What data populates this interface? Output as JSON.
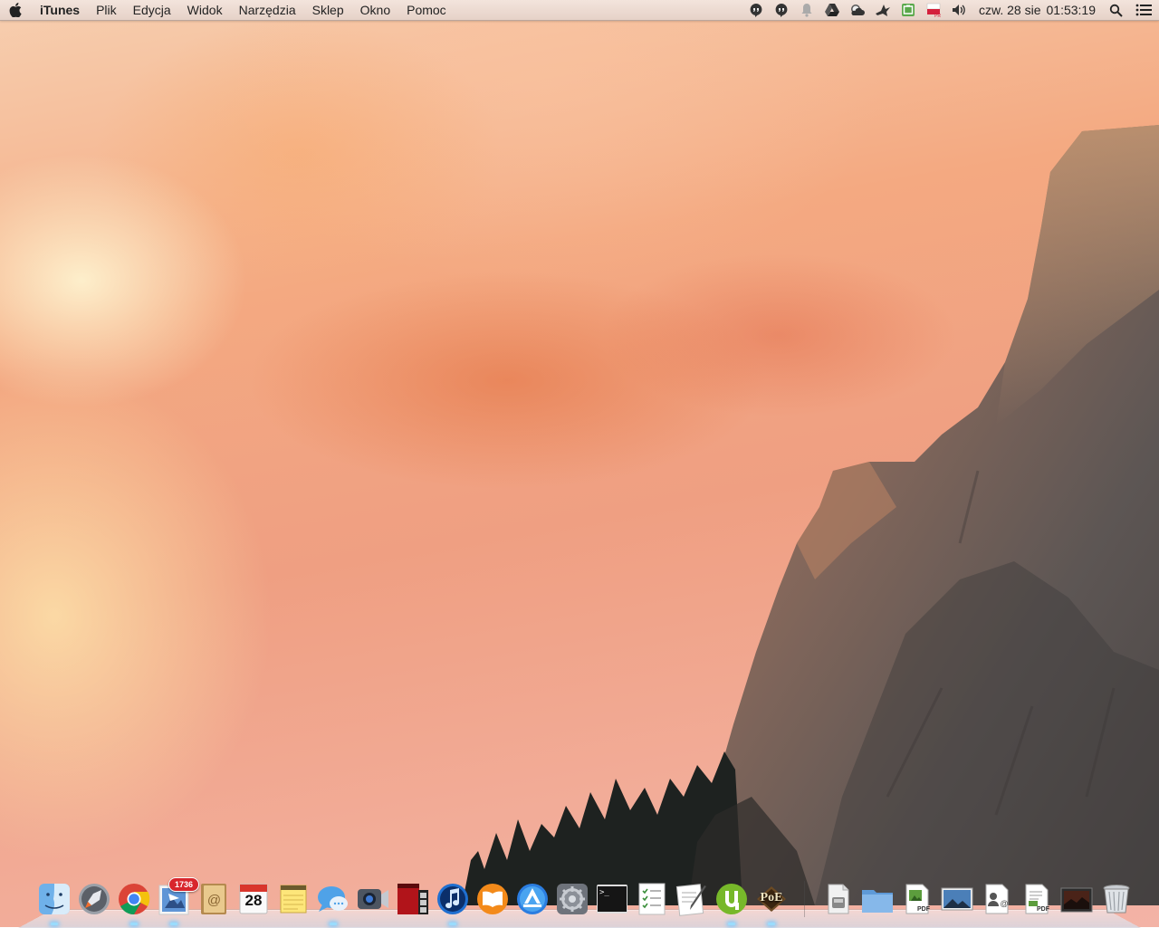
{
  "menubar": {
    "apple_menu": "apple-logo-icon",
    "app_name": "iTunes",
    "items": [
      "Plik",
      "Edycja",
      "Widok",
      "Narzędzia",
      "Sklep",
      "Okno",
      "Pomoc"
    ],
    "status_icons": [
      "hangouts-icon",
      "hangouts-icon",
      "notification-bell-icon",
      "google-drive-icon",
      "weather-icon",
      "bird-icon",
      "battery-app-icon",
      "polish-flag-pro-icon",
      "volume-icon"
    ],
    "clock_date": "czw. 28 sie",
    "clock_time": "01:53:19",
    "spotlight_icon": "magnifier-icon",
    "notification_center_icon": "list-icon"
  },
  "dock": {
    "apps": [
      {
        "name": "finder",
        "icon": "finder-icon",
        "running": true
      },
      {
        "name": "launchpad",
        "icon": "rocket-icon",
        "running": false
      },
      {
        "name": "chrome",
        "icon": "chrome-icon",
        "running": true
      },
      {
        "name": "mail",
        "icon": "mail-stamp-icon",
        "running": true,
        "badge": "1736"
      },
      {
        "name": "contacts",
        "icon": "address-book-icon",
        "running": false
      },
      {
        "name": "calendar",
        "icon": "calendar-icon",
        "running": false,
        "day": "28"
      },
      {
        "name": "notes",
        "icon": "notes-icon",
        "running": false
      },
      {
        "name": "messages",
        "icon": "speech-bubble-icon",
        "running": true
      },
      {
        "name": "facetime",
        "icon": "camera-icon",
        "running": false
      },
      {
        "name": "photo-booth",
        "icon": "photo-booth-icon",
        "running": false
      },
      {
        "name": "itunes",
        "icon": "music-note-icon",
        "running": true
      },
      {
        "name": "ibooks",
        "icon": "book-icon",
        "running": false
      },
      {
        "name": "app-store",
        "icon": "app-store-icon",
        "running": false
      },
      {
        "name": "system-preferences",
        "icon": "gear-icon",
        "running": false
      },
      {
        "name": "terminal",
        "icon": "terminal-icon",
        "running": false,
        "prompt": ">_"
      },
      {
        "name": "reminders",
        "icon": "checklist-icon",
        "running": false
      },
      {
        "name": "textedit",
        "icon": "pen-paper-icon",
        "running": false
      },
      {
        "name": "utorrent",
        "icon": "utorrent-icon",
        "running": true
      },
      {
        "name": "path-of-exile",
        "icon": "poe-icon",
        "running": true,
        "label": "PoE"
      }
    ],
    "stacks": [
      {
        "name": "applications-drive",
        "icon": "drive-icon"
      },
      {
        "name": "folder",
        "icon": "folder-icon"
      },
      {
        "name": "pdf-document",
        "icon": "pdf-file-icon",
        "tag": "PDF"
      },
      {
        "name": "picture",
        "icon": "picture-icon"
      },
      {
        "name": "contact-card",
        "icon": "contact-card-icon"
      },
      {
        "name": "pdf-document-2",
        "icon": "pdf-file-icon",
        "tag": "PDF"
      },
      {
        "name": "screenshot-stack",
        "icon": "screenshot-icon"
      },
      {
        "name": "trash",
        "icon": "trash-icon"
      }
    ]
  },
  "colors": {
    "menubar_bg": "#ecdcd3",
    "badge_red": "#d8262c",
    "sky_top": "#f7cfb0",
    "sky_bottom": "#f3b3a6",
    "rock": "#6a605e"
  }
}
